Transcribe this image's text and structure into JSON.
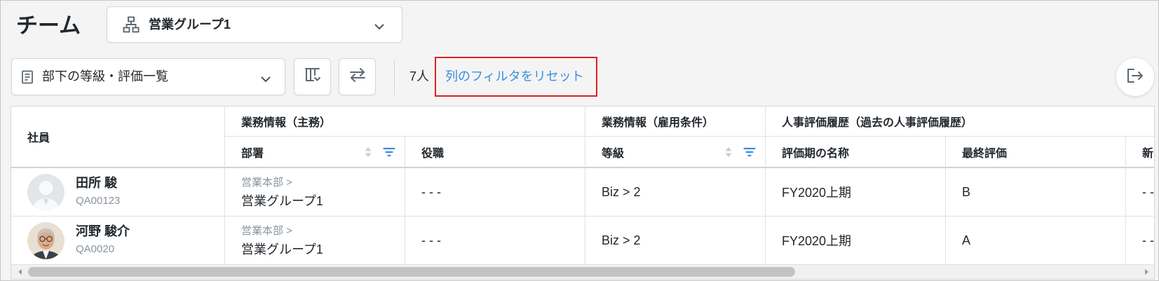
{
  "page": {
    "title": "チーム"
  },
  "group_select": {
    "icon": "org-chart-icon",
    "value": "営業グループ1"
  },
  "toolbar": {
    "view_select": {
      "icon": "document-list-icon",
      "value": "部下の等級・評価一覧"
    },
    "column_settings_icon": "column-settings-icon",
    "swap_icon": "swap-arrows-icon",
    "count": "7人",
    "reset_filters_label": "列のフィルタをリセット",
    "export_icon": "exit-icon"
  },
  "table": {
    "employee_header": "社員",
    "groups": [
      {
        "label": "業務情報（主務）"
      },
      {
        "label": "業務情報（雇用条件）"
      },
      {
        "label": "人事評価履歴（過去の人事評価履歴）"
      }
    ],
    "columns": [
      {
        "label": "部署",
        "sort_icon": "sort-icon",
        "filter_icon": "filter-icon"
      },
      {
        "label": "役職"
      },
      {
        "label": "等級",
        "sort_icon": "sort-icon",
        "filter_icon": "filter-icon"
      },
      {
        "label": "評価期の名称"
      },
      {
        "label": "最終評価"
      },
      {
        "label": "新"
      }
    ],
    "rows": [
      {
        "avatar_icon": "default-person-avatar-icon",
        "name": "田所 駿",
        "employee_code": "QA00123",
        "department_path": "営業本部 >",
        "department": "営業グループ1",
        "position": "- - -",
        "grade": "Biz > 2",
        "evaluation_period": "FY2020上期",
        "final_evaluation": "B",
        "next": "- -"
      },
      {
        "avatar_icon": "user-photo-avatar-icon",
        "name": "河野 駿介",
        "employee_code": "QA0020",
        "department_path": "営業本部 >",
        "department": "営業グループ1",
        "position": "- - -",
        "grade": "Biz > 2",
        "evaluation_period": "FY2020上期",
        "final_evaluation": "A",
        "next": "- -"
      }
    ]
  },
  "colors": {
    "accent": "#3b8ee0",
    "highlight_border": "#e01f1f",
    "text": "#23282d",
    "muted_text": "#8a939c",
    "page_background": "#f4f4f4"
  }
}
